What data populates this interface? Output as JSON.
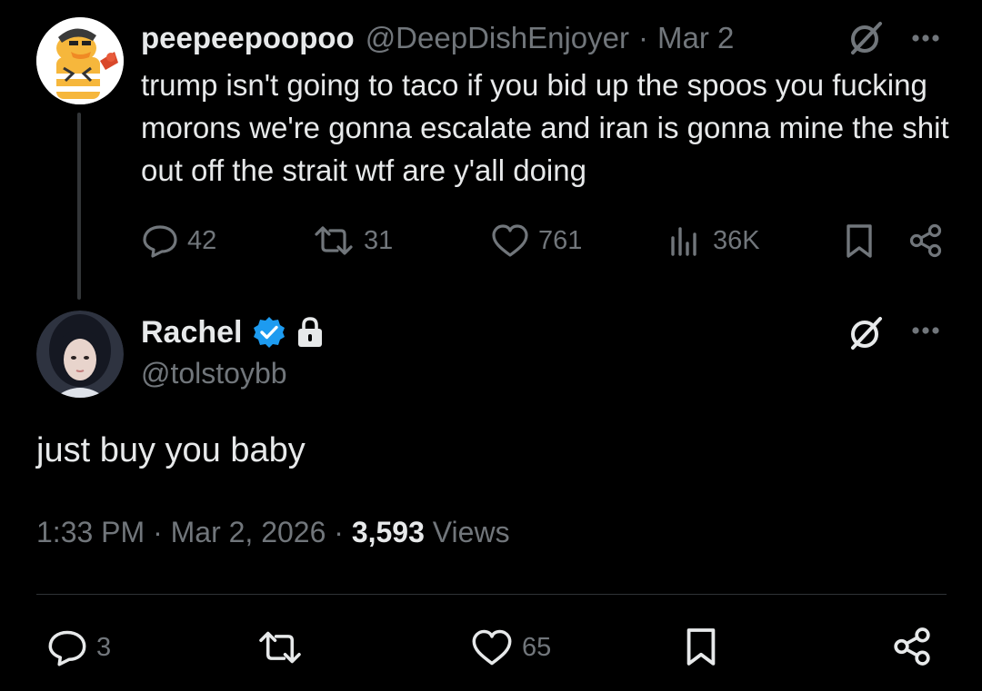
{
  "parent_tweet": {
    "avatar": "duck-avatar",
    "display_name": "peepeepoopoo",
    "handle": "@DeepDishEnjoyer",
    "separator": "·",
    "date": "Mar 2",
    "text": "trump isn't going to taco if you bid up the spoos you fucking morons we're gonna escalate and iran is gonna mine the shit out off the strait wtf are y'all doing",
    "actions": {
      "replies": "42",
      "reposts": "31",
      "likes": "761",
      "views": "36K"
    }
  },
  "reply_tweet": {
    "avatar": "portrait-avatar",
    "display_name": "Rachel",
    "verified": true,
    "protected": true,
    "handle": "@tolstoybb",
    "text": "just buy you baby",
    "time": "1:33 PM",
    "separator": "·",
    "date": "Mar 2, 2026",
    "views_count": "3,593",
    "views_label": "Views",
    "actions": {
      "replies": "3",
      "likes": "65"
    }
  },
  "colors": {
    "background": "#000000",
    "text": "#e7e9ea",
    "muted": "#71767b",
    "verified": "#1d9bf0",
    "divider": "#2f3336"
  }
}
